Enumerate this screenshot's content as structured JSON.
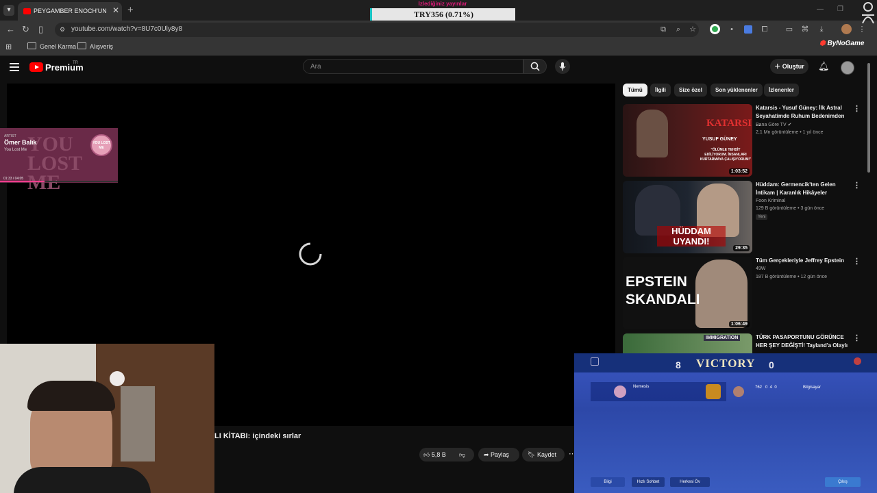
{
  "browser": {
    "tab_title": "PEYGAMBER ENOCH'UN DÜNYA...",
    "url": "youtube.com/watch?v=8U7c0Uly8y8",
    "bookmarks": [
      "Genel Karma",
      "Alışveriş"
    ]
  },
  "overlay": {
    "ticker_top": "Izlediğiniz yayınlar",
    "ticker": "TRY356 (0.71%)",
    "sponsor": "ByNoGame"
  },
  "youtube": {
    "logo": "Premium",
    "logo_region": "TR",
    "search_placeholder": "Ara",
    "create_label": "Oluştur",
    "video_title": "LI KİTABI: içindeki sırlar",
    "like_count": "5,8 B",
    "share_label": "Paylaş",
    "save_label": "Kaydet"
  },
  "music": {
    "artist_tag": "ARTIST",
    "artist": "Ömer Balık",
    "song": "You Lost Me",
    "art_text": "YOU LOST ME",
    "badge_text": "YOU LOST ME",
    "time": "01:33 / 04:05",
    "progress": 0.38
  },
  "chips": [
    "Tümü",
    "İlgili",
    "Size özel",
    "Son yüklenenler",
    "İzlenenler"
  ],
  "recommendations": [
    {
      "title": "Katarsis - Yusuf Güney: İlk Astral Seyahatimde Ruhum Bedenimden ...",
      "channel": "Bana Göre TV",
      "meta": "2,1 Mn görüntüleme • 1 yıl önce",
      "duration": "1:03:52",
      "thumb_text": "KATARSIS",
      "thumb_sub": "YUSUF GÜNEY",
      "thumb_quote": "\"ÖLÜMLE TEHDİT EDİLİYORUM. İNSANLARI KURTARMAYA ÇALIŞIYORUM!\"",
      "badge": ""
    },
    {
      "title": "Hüddam: Germencik'ten Gelen İntikam | Karanlık Hikâyeler",
      "channel": "Foon Kriminal",
      "meta": "129 B görüntüleme • 3 gün önce",
      "duration": "29:35",
      "thumb_text": "HÜDDAM UYANDI!",
      "thumb_sub": "",
      "thumb_quote": "",
      "badge": "Yeni"
    },
    {
      "title": "Tüm Gerçekleriyle Jeffrey Epstein",
      "channel": "49W",
      "meta": "187 B görüntüleme • 12 gün önce",
      "duration": "1:06:49",
      "thumb_text": "EPSTEIN SKANDALI",
      "thumb_sub": "",
      "thumb_quote": "",
      "badge": ""
    },
    {
      "title": "TÜRK PASAPORTUNU GÖRÜNCE HER ŞEY DEĞİŞTİ! Tayland'a Olaylı ...",
      "channel": "",
      "meta": "",
      "duration": "",
      "thumb_text": "IMMIGRATION",
      "thumb_sub": "",
      "thumb_quote": "",
      "badge": ""
    }
  ],
  "game": {
    "result": "VICTORY",
    "score_left": "8",
    "score_right": "0",
    "player_left": "Nemesis",
    "player_right": "Bilgisayar",
    "right_stat": "762   0  4  0",
    "btn_info": "Bilgi",
    "btn_chat": "Hızlı Sohbet",
    "btn_all": "Herkesi Öv",
    "btn_exit": "Çıkış"
  },
  "colors": {
    "yt_red": "#ff0000",
    "bg": "#0f0f0f",
    "accent_pink": "#e0197a"
  }
}
